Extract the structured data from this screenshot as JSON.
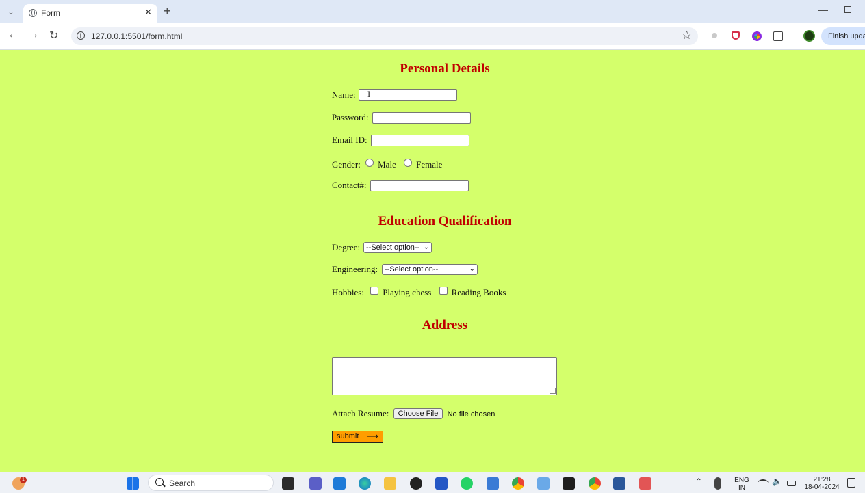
{
  "browser": {
    "tab_title": "Form",
    "url": "127.0.0.1:5501/form.html",
    "finish_update_label": "Finish update"
  },
  "form": {
    "personal_title": "Personal Details",
    "name_label": "Name:",
    "password_label": "Password:",
    "email_label": "Email ID:",
    "gender_label": "Gender:",
    "gender_male": "Male",
    "gender_female": "Female",
    "contact_label": "Contact#:",
    "education_title": "Education Qualification",
    "degree_label": "Degree:",
    "degree_selected": "--Select option--",
    "engineering_label": "Engineering:",
    "engineering_selected": "--Select option--",
    "hobbies_label": "Hobbies:",
    "hobby_chess": "Playing chess",
    "hobby_books": "Reading Books",
    "address_title": "Address",
    "resume_label": "Attach Resume:",
    "choose_file": "Choose File",
    "no_file": "No file chosen",
    "submit_label": "submit",
    "submit_arrow": "⟶"
  },
  "taskbar": {
    "search_label": "Search",
    "lang_line1": "ENG",
    "lang_line2": "IN",
    "time": "21:28",
    "date": "18-04-2024",
    "notification_badge": "1"
  },
  "colors": {
    "page_bg": "#d4ff6b",
    "heading": "#c00000",
    "submit_bg": "#ff9d00"
  }
}
